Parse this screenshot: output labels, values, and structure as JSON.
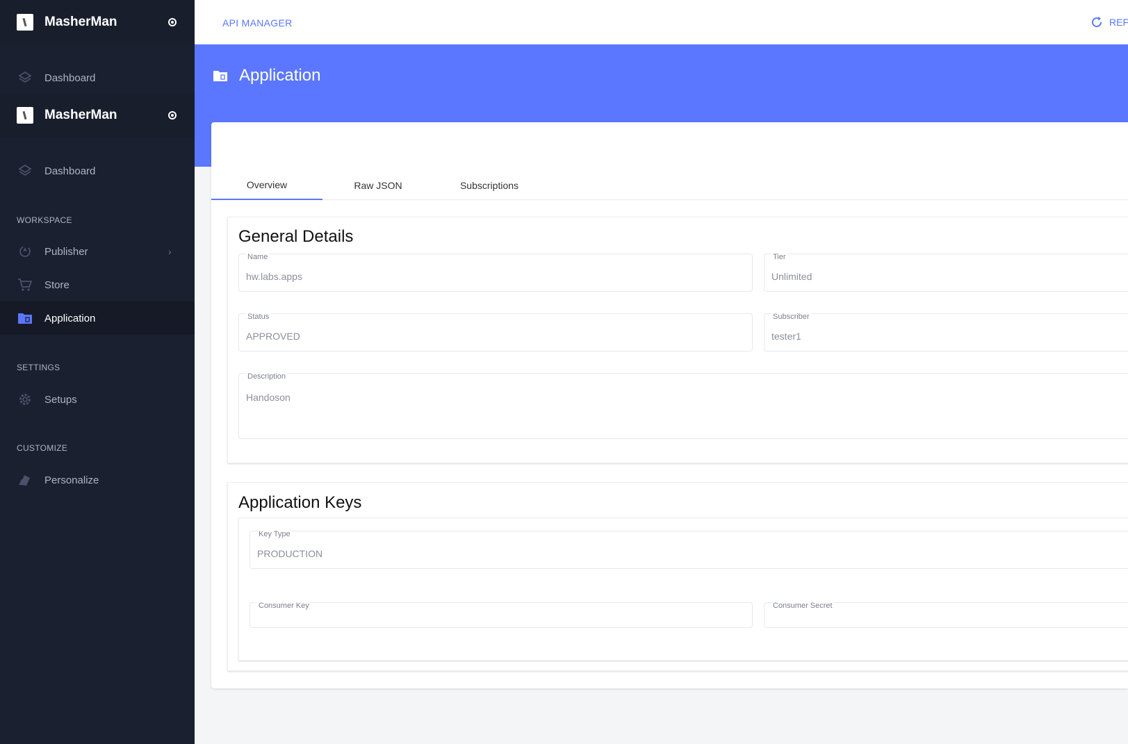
{
  "sidebar": {
    "brand_name": "MasherMan",
    "brand_name_2": "MasherMan",
    "dashboard_label": "Dashboard",
    "dashboard_label_2": "Dashboard",
    "sections": {
      "workspace": "WORKSPACE",
      "settings": "SETTINGS",
      "customize": "CUSTOMIZE"
    },
    "items": {
      "publisher": "Publisher",
      "store": "Store",
      "application": "Application",
      "setups": "Setups",
      "personalize": "Personalize"
    },
    "accent_color": "#5b77ff"
  },
  "topbar": {
    "breadcrumb": "API MANAGER",
    "refresh_label": "REF"
  },
  "header": {
    "title": "Application"
  },
  "tabs": {
    "overview": "Overview",
    "raw_json": "Raw JSON",
    "subscriptions": "Subscriptions"
  },
  "general": {
    "title": "General Details",
    "name_label": "Name",
    "name_value": "hw.labs.apps",
    "tier_label": "Tier",
    "tier_value": "Unlimited",
    "status_label": "Status",
    "status_value": "APPROVED",
    "subscriber_label": "Subscriber",
    "subscriber_value": "tester1",
    "description_label": "Description",
    "description_value": "Handoson"
  },
  "keys": {
    "title": "Application Keys",
    "key_type_label": "Key Type",
    "key_type_value": "PRODUCTION",
    "consumer_key_label": "Consumer Key",
    "consumer_key_value": "",
    "consumer_secret_label": "Consumer Secret",
    "consumer_secret_value": ""
  }
}
